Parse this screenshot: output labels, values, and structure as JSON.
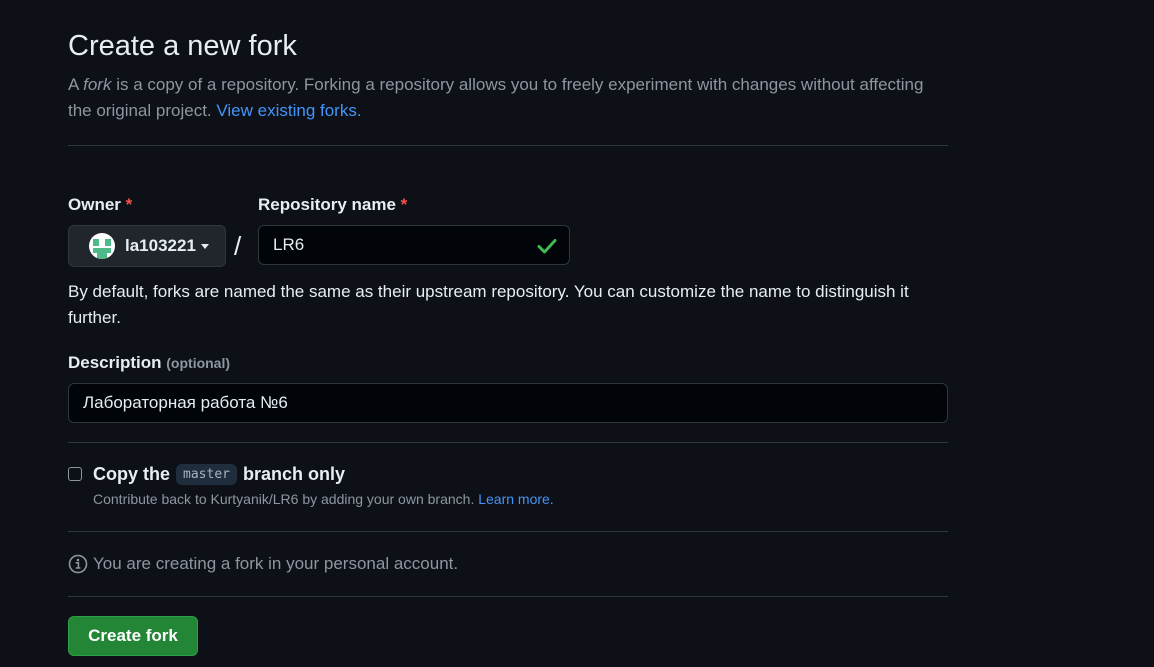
{
  "header": {
    "title": "Create a new fork",
    "intro_prefix": "A ",
    "intro_fork_word": "fork",
    "intro_text": " is a copy of a repository. Forking a repository allows you to freely experiment with changes without affecting the original project. ",
    "intro_link": "View existing forks."
  },
  "form": {
    "owner_label": "Owner",
    "required_mark": "*",
    "owner_value": "la103221",
    "separator": "/",
    "repo_label": "Repository name",
    "repo_value": "LR6",
    "repo_help": "By default, forks are named the same as their upstream repository. You can customize the name to distinguish it further.",
    "description_label": "Description",
    "description_optional": "(optional)",
    "description_value": "Лабораторная работа №6"
  },
  "copy_branch": {
    "checked": false,
    "label_prefix": "Copy the",
    "branch": "master",
    "label_suffix": "branch only",
    "sub_text": "Contribute back to Kurtyanik/LR6 by adding your own branch. ",
    "sub_link": "Learn more."
  },
  "info": {
    "icon": "info-icon",
    "text": "You are creating a fork in your personal account."
  },
  "actions": {
    "create_label": "Create fork"
  },
  "colors": {
    "background": "#0d1117",
    "link": "#4493f8",
    "primary_button": "#238636",
    "required": "#f85149",
    "success_check": "#3fb950"
  }
}
